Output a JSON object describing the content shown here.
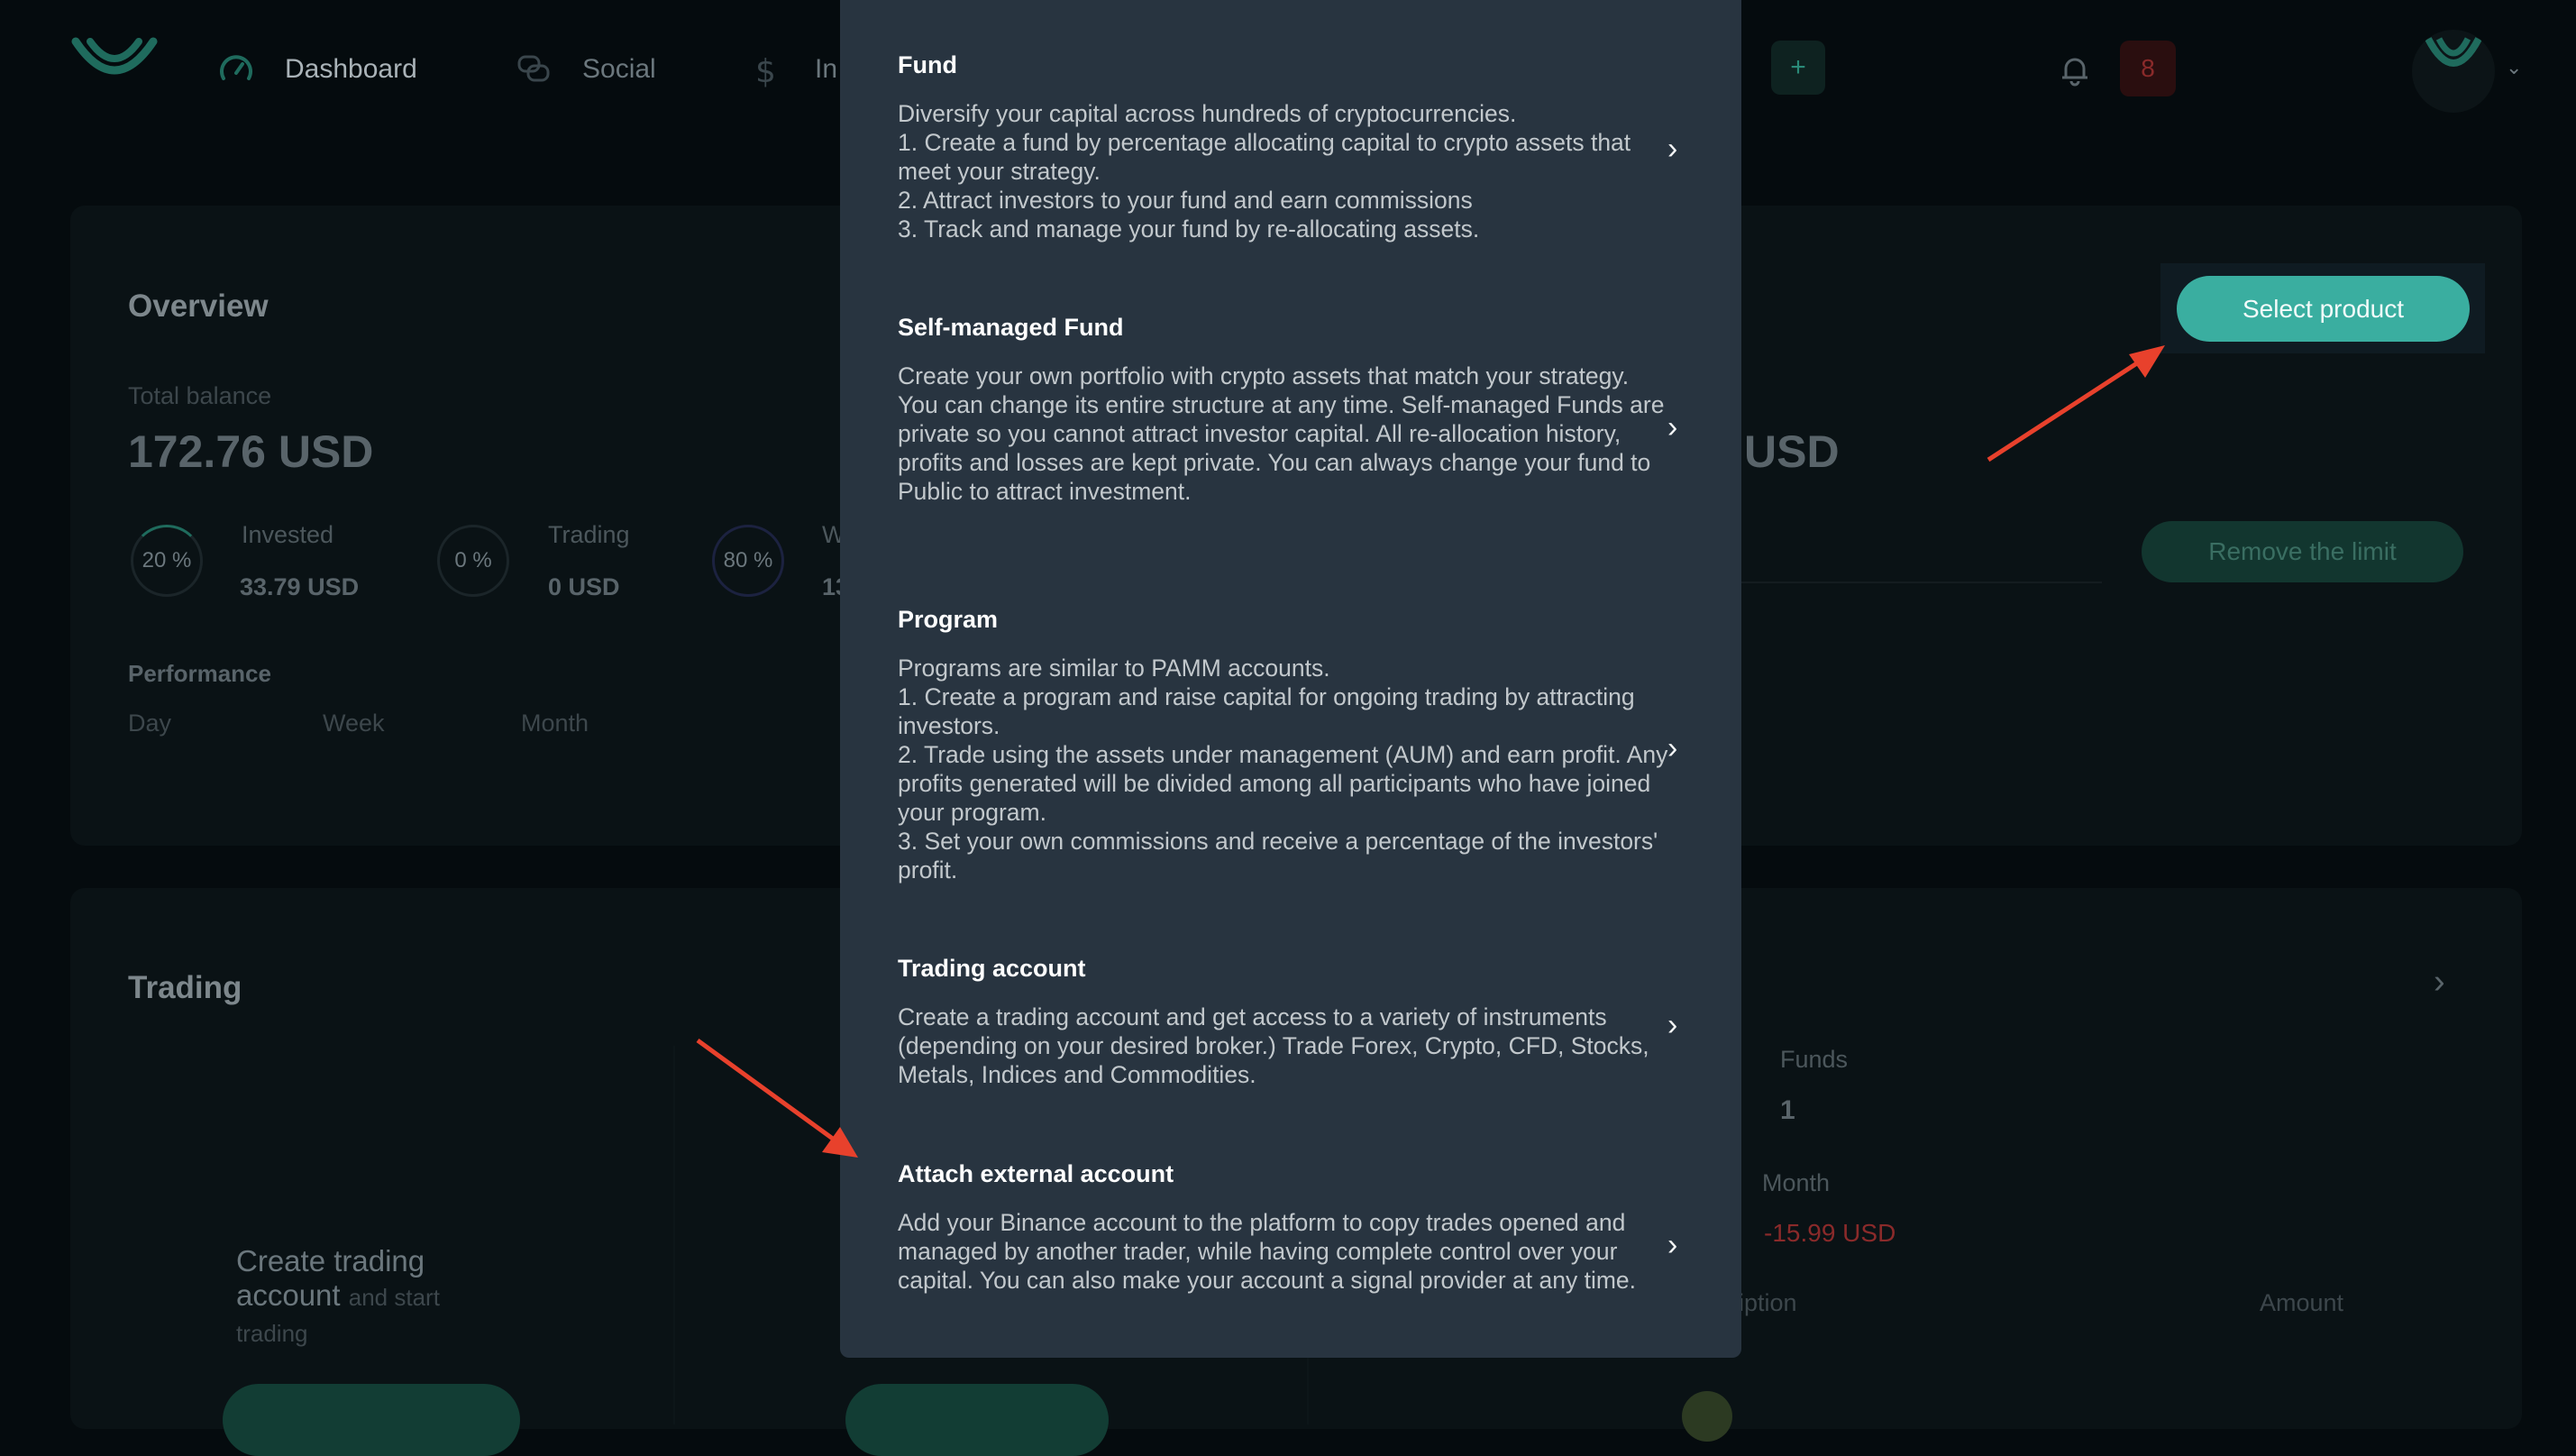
{
  "nav": {
    "items": [
      {
        "label": "Dashboard",
        "icon": "dashboard-gauge-icon"
      },
      {
        "label": "Social",
        "icon": "chat-bubbles-icon"
      },
      {
        "label": "In",
        "icon": "dollar-icon"
      }
    ],
    "plus_label": "+",
    "notifications_count": "8"
  },
  "overview": {
    "title": "Overview",
    "total_balance_label": "Total balance",
    "total_balance_value": "172.76 USD",
    "right_balance_fragment": "USD",
    "stats": [
      {
        "percent": "20 %",
        "label": "Invested",
        "value": "33.79 USD"
      },
      {
        "percent": "0 %",
        "label": "Trading",
        "value": "0 USD"
      },
      {
        "percent": "80 %",
        "label": "W",
        "value": "13"
      }
    ],
    "performance_label": "Performance",
    "periods": [
      "Day",
      "Week",
      "Month"
    ],
    "select_product_label": "Select product",
    "remove_limit_label": "Remove the limit"
  },
  "trading": {
    "title": "Trading",
    "create_title_bold": "Create trading account",
    "create_title_rest": "and start trading",
    "funds_label": "Funds",
    "funds_value": "1",
    "month_label": "Month",
    "month_value": "-15.99 USD",
    "col_description_fragment": "ription",
    "col_amount": "Amount"
  },
  "modal": {
    "items": [
      {
        "title": "Fund",
        "description": "Diversify your capital across hundreds of cryptocurrencies.\n1. Create a fund by percentage allocating capital to crypto assets that meet your strategy.\n2. Attract investors to your fund and earn commissions\n3. Track and manage your fund by re-allocating assets."
      },
      {
        "title": "Self-managed Fund",
        "description": "Create your own portfolio with crypto assets that match your strategy. You can change its entire structure at any time. Self-managed Funds are private so you cannot attract investor capital. All re-allocation history, profits and losses are kept private. You can always change your fund to Public to attract investment."
      },
      {
        "title": "Program",
        "description": "Programs are similar to PAMM accounts.\n1. Create a program and raise capital for ongoing trading by attracting investors.\n2. Trade using the assets under management (AUM) and earn profit. Any profits generated will be divided among all participants who have joined your program.\n3. Set your own commissions and receive a percentage of the investors' profit."
      },
      {
        "title": "Trading account",
        "description": "Create a trading account and get access to a variety of instruments (depending on your desired broker.) Trade Forex, Crypto, CFD, Stocks, Metals, Indices and Commodities."
      },
      {
        "title": "Attach external account",
        "description": "Add your Binance account to the platform to copy trades opened and managed by another trader, while having complete control over your capital. You can also make your account a signal provider at any time."
      }
    ],
    "chevron": "›"
  },
  "colors": {
    "accent": "#3aaea0",
    "modal_bg": "#283440",
    "annotation_arrow": "#e8412c",
    "negative": "#8a2a2a"
  }
}
